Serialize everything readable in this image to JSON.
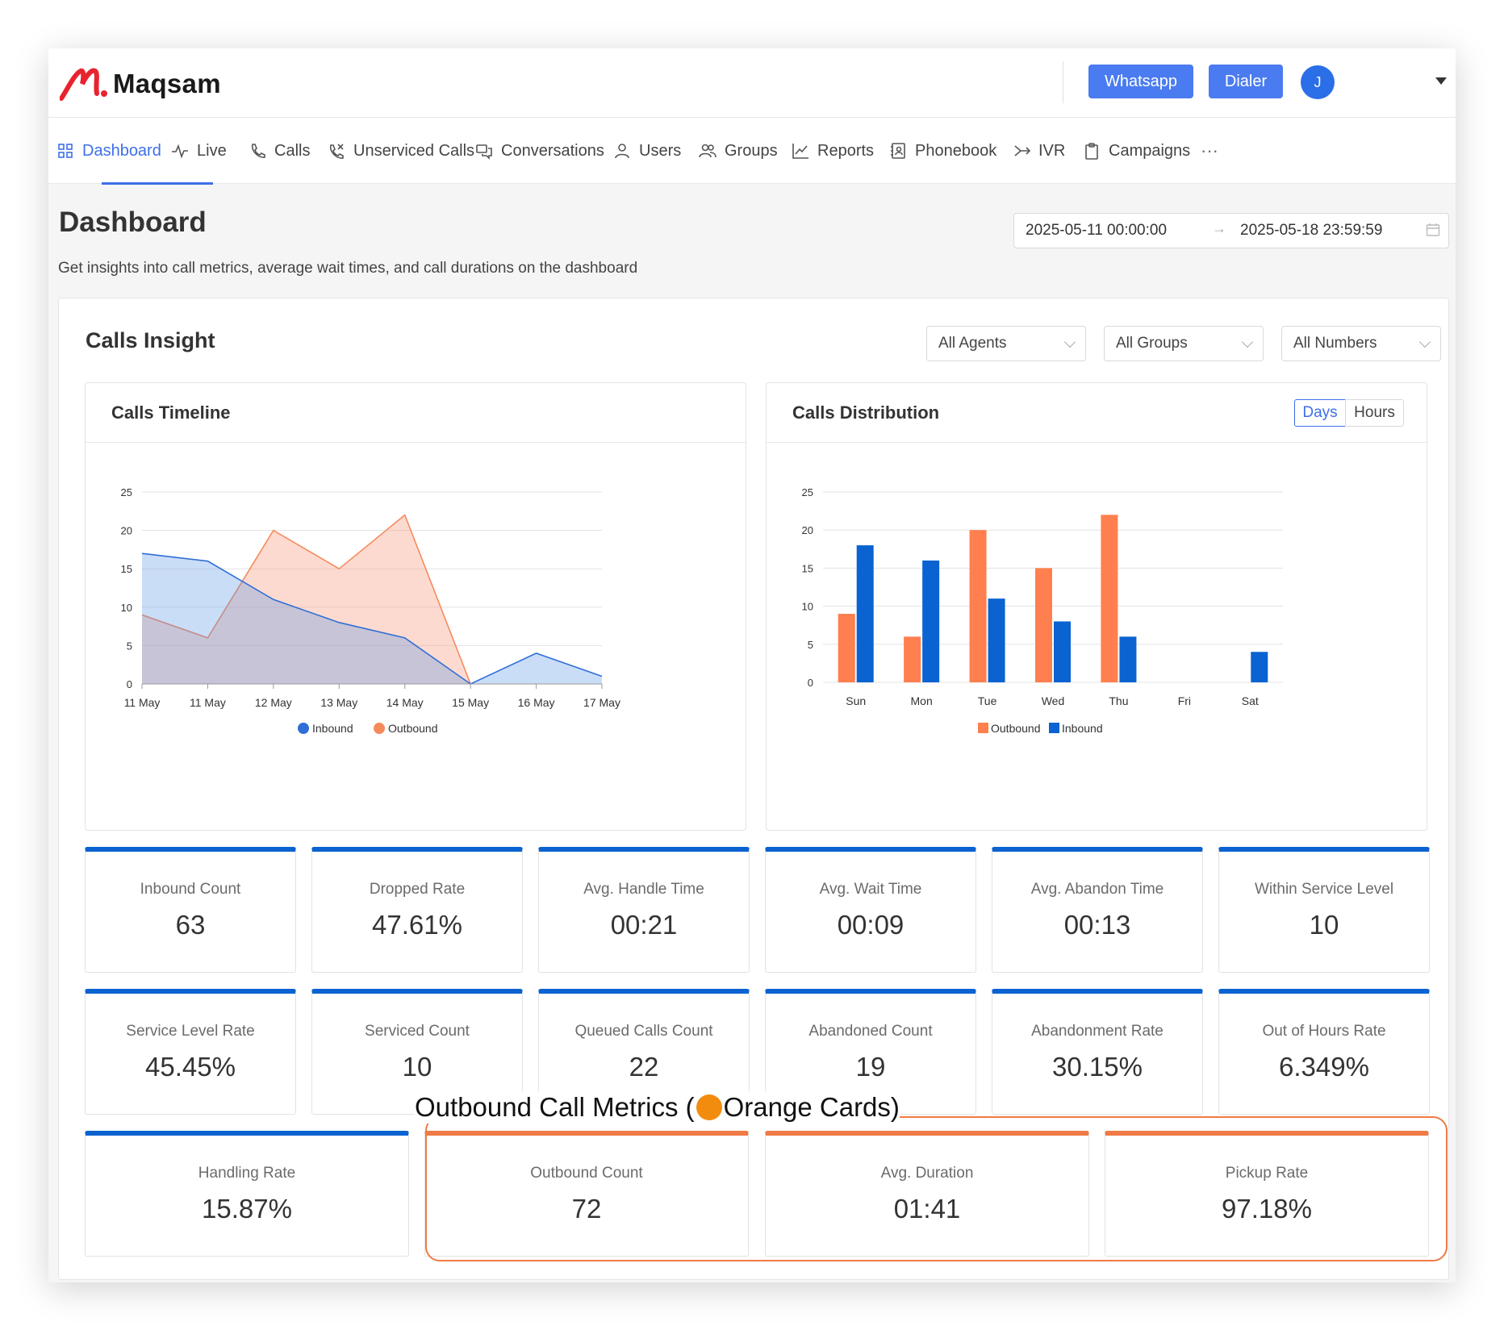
{
  "brand": {
    "name": "Maqsam"
  },
  "header": {
    "whatsapp_label": "Whatsapp",
    "dialer_label": "Dialer",
    "avatar_initial": "J"
  },
  "nav": {
    "items": [
      {
        "label": "Dashboard",
        "icon": "grid-icon"
      },
      {
        "label": "Live",
        "icon": "pulse-icon"
      },
      {
        "label": "Calls",
        "icon": "phone-icon"
      },
      {
        "label": "Unserviced Calls",
        "icon": "phone-missed-icon"
      },
      {
        "label": "Conversations",
        "icon": "chat-icon"
      },
      {
        "label": "Users",
        "icon": "user-icon"
      },
      {
        "label": "Groups",
        "icon": "group-icon"
      },
      {
        "label": "Reports",
        "icon": "line-chart-icon"
      },
      {
        "label": "Phonebook",
        "icon": "phonebook-icon"
      },
      {
        "label": "IVR",
        "icon": "ivr-icon"
      },
      {
        "label": "Campaigns",
        "icon": "clipboard-icon"
      }
    ],
    "more": "···",
    "active": "Dashboard"
  },
  "page": {
    "title": "Dashboard",
    "subtitle": "Get insights into call metrics, average wait times, and call durations on the dashboard",
    "date_start": "2025-05-11 00:00:00",
    "date_arrow": "→",
    "date_end": "2025-05-18 23:59:59"
  },
  "insight": {
    "title": "Calls Insight",
    "filters": {
      "agents": "All Agents",
      "groups": "All Groups",
      "numbers": "All Numbers"
    }
  },
  "timeline": {
    "title": "Calls Timeline"
  },
  "distribution": {
    "title": "Calls Distribution",
    "toggle_days": "Days",
    "toggle_hours": "Hours"
  },
  "chart_data": [
    {
      "type": "area",
      "title": "Calls Timeline",
      "x": [
        "11 May",
        "11 May",
        "12 May",
        "13 May",
        "14 May",
        "15 May",
        "16 May",
        "17 May"
      ],
      "ylim": [
        0,
        25
      ],
      "yticks": [
        0,
        5,
        10,
        15,
        20,
        25
      ],
      "grid": true,
      "legend": "bottom",
      "series": [
        {
          "name": "Inbound",
          "color": "#2f6fd6",
          "values": [
            17,
            16,
            11,
            8,
            6,
            0,
            4,
            1
          ]
        },
        {
          "name": "Outbound",
          "color": "#f58a5c",
          "values": [
            9,
            6,
            20,
            15,
            22,
            0,
            null,
            null
          ]
        }
      ]
    },
    {
      "type": "bar",
      "title": "Calls Distribution",
      "categories": [
        "Sun",
        "Mon",
        "Tue",
        "Wed",
        "Thu",
        "Fri",
        "Sat"
      ],
      "ylim": [
        0,
        25
      ],
      "yticks": [
        0,
        5,
        10,
        15,
        20,
        25
      ],
      "grid": true,
      "legend": "bottom",
      "series": [
        {
          "name": "Outbound",
          "color": "#ff7f4f",
          "values": [
            9,
            6,
            20,
            15,
            22,
            0,
            0
          ]
        },
        {
          "name": "Inbound",
          "color": "#0a63d1",
          "values": [
            18,
            16,
            11,
            8,
            6,
            0,
            4
          ]
        }
      ]
    }
  ],
  "metrics": {
    "inbound_count": {
      "label": "Inbound Count",
      "value": "63"
    },
    "dropped_rate": {
      "label": "Dropped Rate",
      "value": "47.61%"
    },
    "avg_handle_time": {
      "label": "Avg. Handle Time",
      "value": "00:21"
    },
    "avg_wait_time": {
      "label": "Avg. Wait Time",
      "value": "00:09"
    },
    "avg_abandon_time": {
      "label": "Avg. Abandon Time",
      "value": "00:13"
    },
    "within_service_level": {
      "label": "Within Service Level",
      "value": "10"
    },
    "service_level_rate": {
      "label": "Service Level Rate",
      "value": "45.45%"
    },
    "serviced_count": {
      "label": "Serviced Count",
      "value": "10"
    },
    "queued_calls_count": {
      "label": "Queued Calls Count",
      "value": "22"
    },
    "abandoned_count": {
      "label": "Abandoned Count",
      "value": "19"
    },
    "abandonment_rate": {
      "label": "Abandonment Rate",
      "value": "30.15%"
    },
    "out_of_hours_rate": {
      "label": "Out of Hours Rate",
      "value": "6.349%"
    },
    "handling_rate": {
      "label": "Handling Rate",
      "value": "15.87%"
    },
    "outbound_count": {
      "label": "Outbound Count",
      "value": "72"
    },
    "avg_duration": {
      "label": "Avg. Duration",
      "value": "01:41"
    },
    "pickup_rate": {
      "label": "Pickup Rate",
      "value": "97.18%"
    }
  },
  "annotation": {
    "prefix": "Outbound Call Metrics (",
    "suffix": " Orange Cards)",
    "dot_color": "#f28c0f"
  }
}
